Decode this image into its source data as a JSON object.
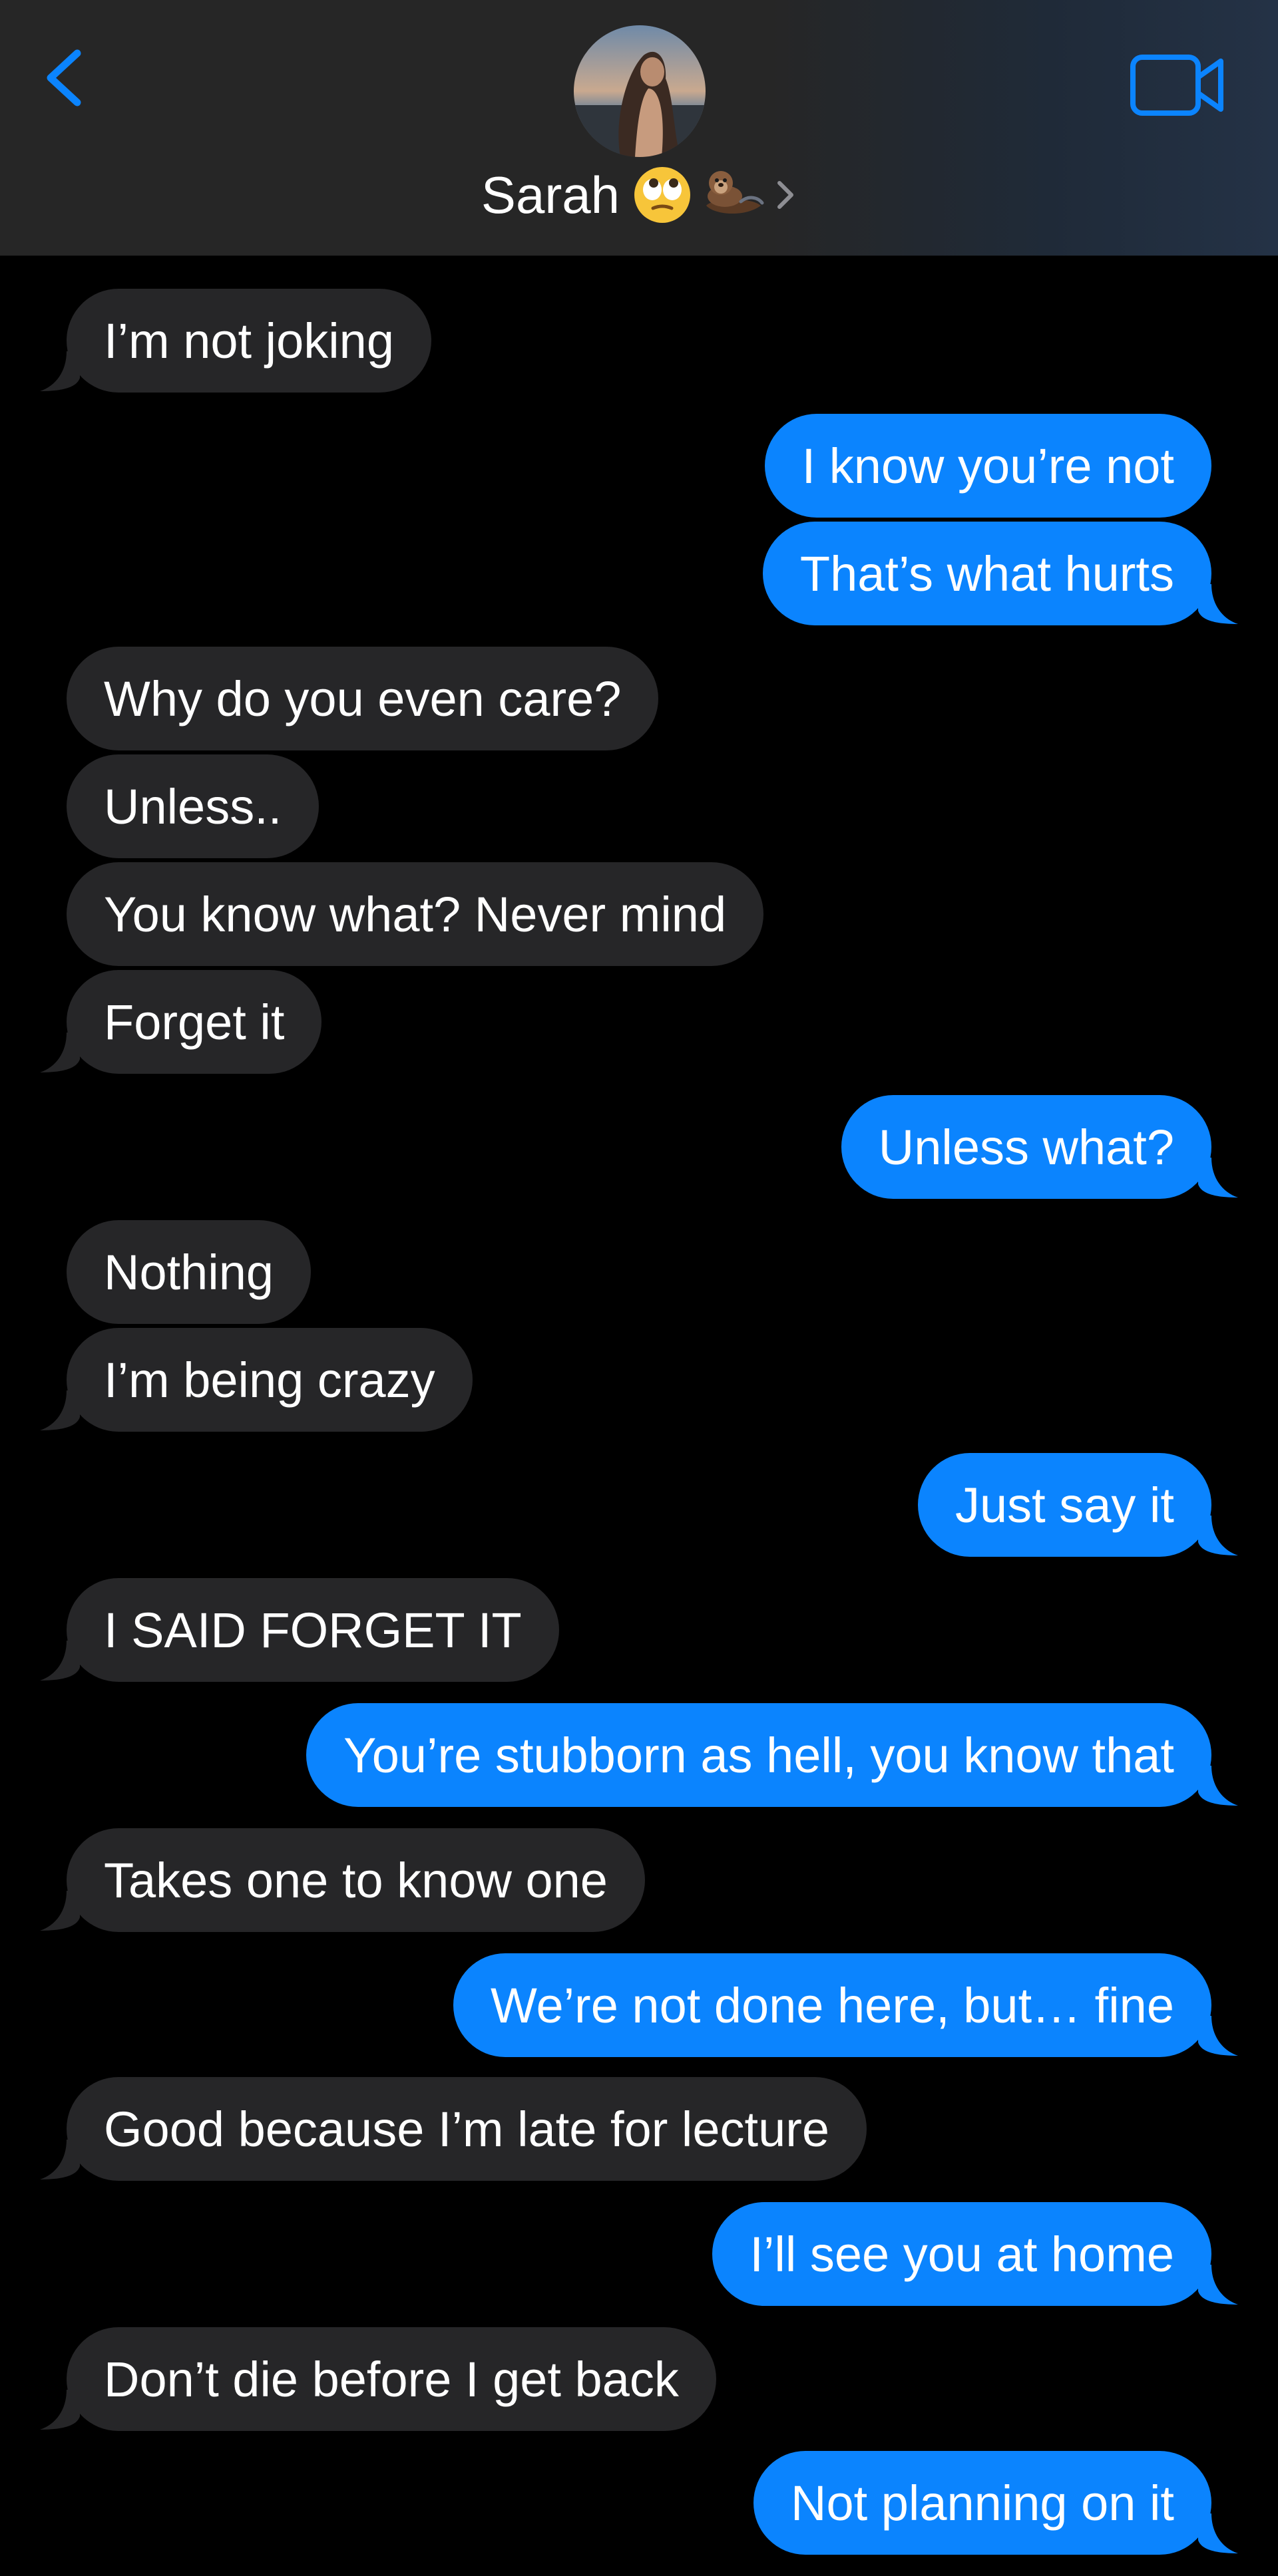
{
  "header": {
    "contact_name": "Sarah",
    "name_emojis": [
      "face-with-rolling-eyes",
      "otter"
    ],
    "back_icon": "chevron-left-icon",
    "video_icon": "video-camera-icon",
    "avatar_alt": "contact photo"
  },
  "colors": {
    "incoming_bubble": "#262628",
    "outgoing_bubble": "#0b84fe",
    "accent": "#0b84fe",
    "background": "#000000"
  },
  "messages": [
    {
      "dir": "in",
      "text": "I’m not joking"
    },
    {
      "dir": "out",
      "text": "I know you’re not"
    },
    {
      "dir": "out",
      "text": "That’s what hurts"
    },
    {
      "dir": "in",
      "text": "Why do you even care?"
    },
    {
      "dir": "in",
      "text": "Unless.."
    },
    {
      "dir": "in",
      "text": "You know what? Never mind"
    },
    {
      "dir": "in",
      "text": "Forget it"
    },
    {
      "dir": "out",
      "text": "Unless what?"
    },
    {
      "dir": "in",
      "text": "Nothing"
    },
    {
      "dir": "in",
      "text": "I’m being crazy"
    },
    {
      "dir": "out",
      "text": "Just say it"
    },
    {
      "dir": "in",
      "text": "I SAID FORGET IT"
    },
    {
      "dir": "out",
      "text": "You’re stubborn as hell, you know that"
    },
    {
      "dir": "in",
      "text": "Takes one to know one"
    },
    {
      "dir": "out",
      "text": "We’re not done here, but… fine"
    },
    {
      "dir": "in",
      "text": "Good because I’m late for lecture"
    },
    {
      "dir": "out",
      "text": "I’ll see you at home"
    },
    {
      "dir": "in",
      "text": "Don’t die before I get back"
    },
    {
      "dir": "out",
      "text": "Not planning on it"
    }
  ]
}
